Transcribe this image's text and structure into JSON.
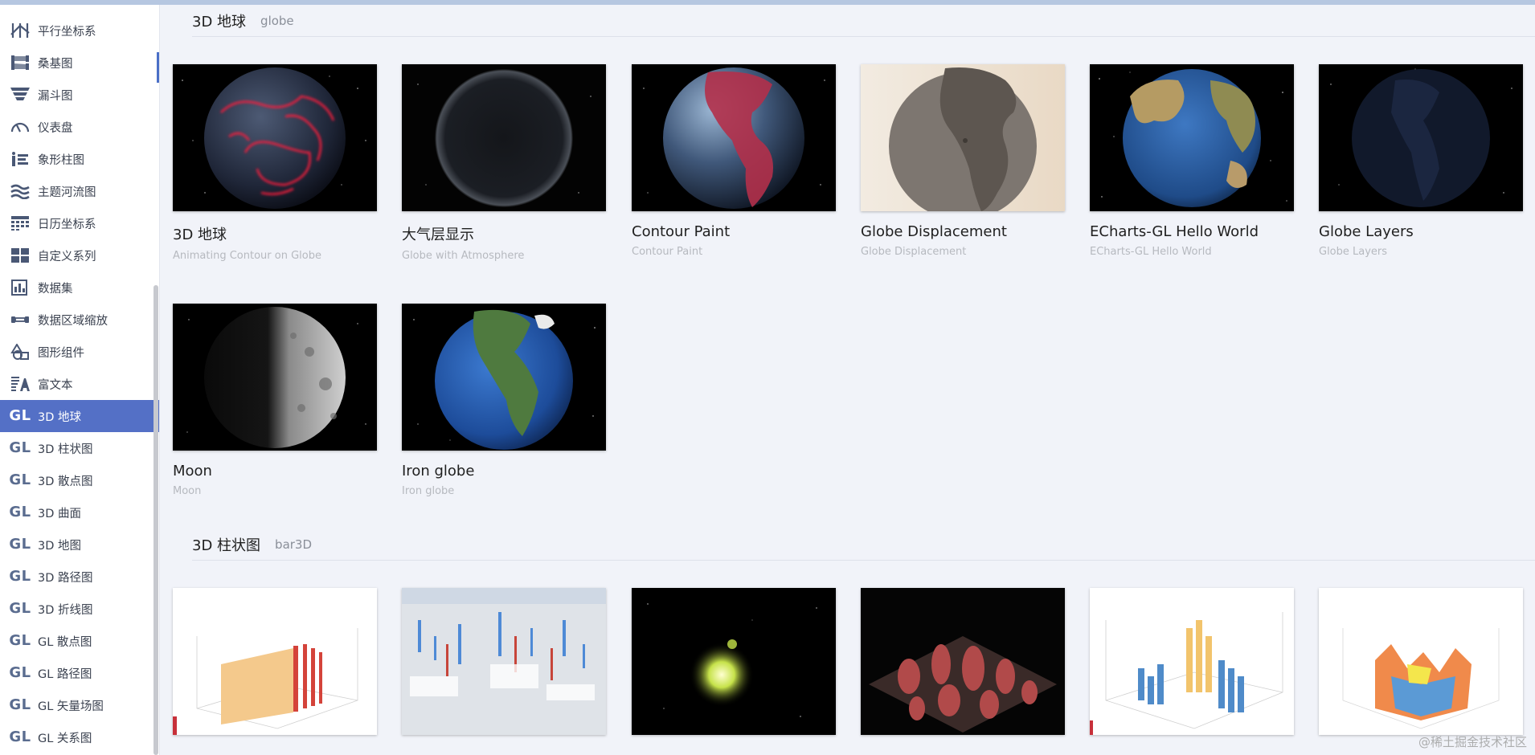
{
  "sidebar": {
    "items": [
      {
        "label": "平行坐标系",
        "icon": "parallel-icon"
      },
      {
        "label": "桑基图",
        "icon": "sankey-icon"
      },
      {
        "label": "漏斗图",
        "icon": "funnel-icon"
      },
      {
        "label": "仪表盘",
        "icon": "gauge-icon"
      },
      {
        "label": "象形柱图",
        "icon": "pictorial-bar-icon"
      },
      {
        "label": "主题河流图",
        "icon": "theme-river-icon"
      },
      {
        "label": "日历坐标系",
        "icon": "calendar-icon"
      },
      {
        "label": "自定义系列",
        "icon": "custom-series-icon"
      },
      {
        "label": "数据集",
        "icon": "dataset-icon"
      },
      {
        "label": "数据区域缩放",
        "icon": "datazoom-icon"
      },
      {
        "label": "图形组件",
        "icon": "graphic-icon"
      },
      {
        "label": "富文本",
        "icon": "rich-text-icon"
      },
      {
        "label": "3D 地球",
        "icon": "gl-icon",
        "active": true
      },
      {
        "label": "3D 柱状图",
        "icon": "gl-icon"
      },
      {
        "label": "3D 散点图",
        "icon": "gl-icon"
      },
      {
        "label": "3D 曲面",
        "icon": "gl-icon"
      },
      {
        "label": "3D 地图",
        "icon": "gl-icon"
      },
      {
        "label": "3D 路径图",
        "icon": "gl-icon"
      },
      {
        "label": "3D 折线图",
        "icon": "gl-icon"
      },
      {
        "label": "GL 散点图",
        "icon": "gl-icon"
      },
      {
        "label": "GL 路径图",
        "icon": "gl-icon"
      },
      {
        "label": "GL 矢量场图",
        "icon": "gl-icon"
      },
      {
        "label": "GL 关系图",
        "icon": "gl-icon"
      }
    ],
    "gl_text": "GL"
  },
  "sections": [
    {
      "title": "3D 地球",
      "subtitle": "globe",
      "cards": [
        {
          "title": "3D 地球",
          "subtitle": "Animating Contour on Globe"
        },
        {
          "title": "大气层显示",
          "subtitle": "Globe with Atmosphere"
        },
        {
          "title": "Contour Paint",
          "subtitle": "Contour Paint"
        },
        {
          "title": "Globe Displacement",
          "subtitle": "Globe Displacement"
        },
        {
          "title": "ECharts-GL Hello World",
          "subtitle": "ECharts-GL Hello World"
        },
        {
          "title": "Globe Layers",
          "subtitle": "Globe Layers"
        },
        {
          "title": "Moon",
          "subtitle": "Moon"
        },
        {
          "title": "Iron globe",
          "subtitle": "Iron globe"
        }
      ]
    },
    {
      "title": "3D 柱状图",
      "subtitle": "bar3D"
    }
  ],
  "watermark": "@稀土掘金技术社区",
  "colors": {
    "accent": "#5470c6",
    "sidebar_text": "#3b4250",
    "background": "#f1f3f9"
  }
}
